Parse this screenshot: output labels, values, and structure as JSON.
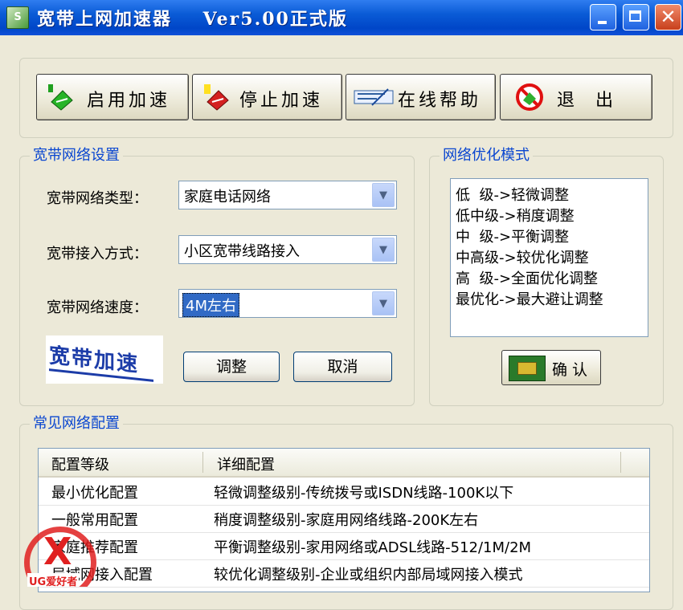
{
  "window": {
    "title": "宽带上网加速器    Ver5.00正式版",
    "icon_text": "S"
  },
  "toolbar": {
    "start": "启用加速",
    "stop": "停止加速",
    "help": "在线帮助",
    "exit": "退  出"
  },
  "settings": {
    "title": "宽带网络设置",
    "type_label": "宽带网络类型：",
    "type_value": "家庭电话网络",
    "access_label": "宽带接入方式：",
    "access_value": "小区宽带线路接入",
    "speed_label": "宽带网络速度：",
    "speed_value": "4M左右",
    "logo": "宽带加速",
    "adjust": "调整",
    "cancel": "取消"
  },
  "optimize": {
    "title": "网络优化模式",
    "items": [
      "低  级->轻微调整",
      "低中级->稍度调整",
      "中  级->平衡调整",
      "中高级->较优化调整",
      "高  级->全面优化调整",
      "最优化->最大避让调整"
    ],
    "confirm": "确认"
  },
  "common": {
    "title": "常见网络配置",
    "headers": [
      "配置等级",
      "详细配置"
    ],
    "rows": [
      [
        "最小优化配置",
        "轻微调整级别-传统拨号或ISDN线路-100K以下"
      ],
      [
        "一般常用配置",
        "稍度调整级别-家庭用网络线路-200K左右"
      ],
      [
        "家庭推荐配置",
        "平衡调整级别-家用网络或ADSL线路-512/1M/2M"
      ],
      [
        "局域网接入配置",
        "较优化调整级别-企业或组织内部局域网接入模式"
      ]
    ]
  },
  "watermark": "UG爱好者",
  "colors": {
    "title_bar": "#0a5bd6",
    "group_title": "#0a46d0",
    "selection": "#316ac5"
  }
}
